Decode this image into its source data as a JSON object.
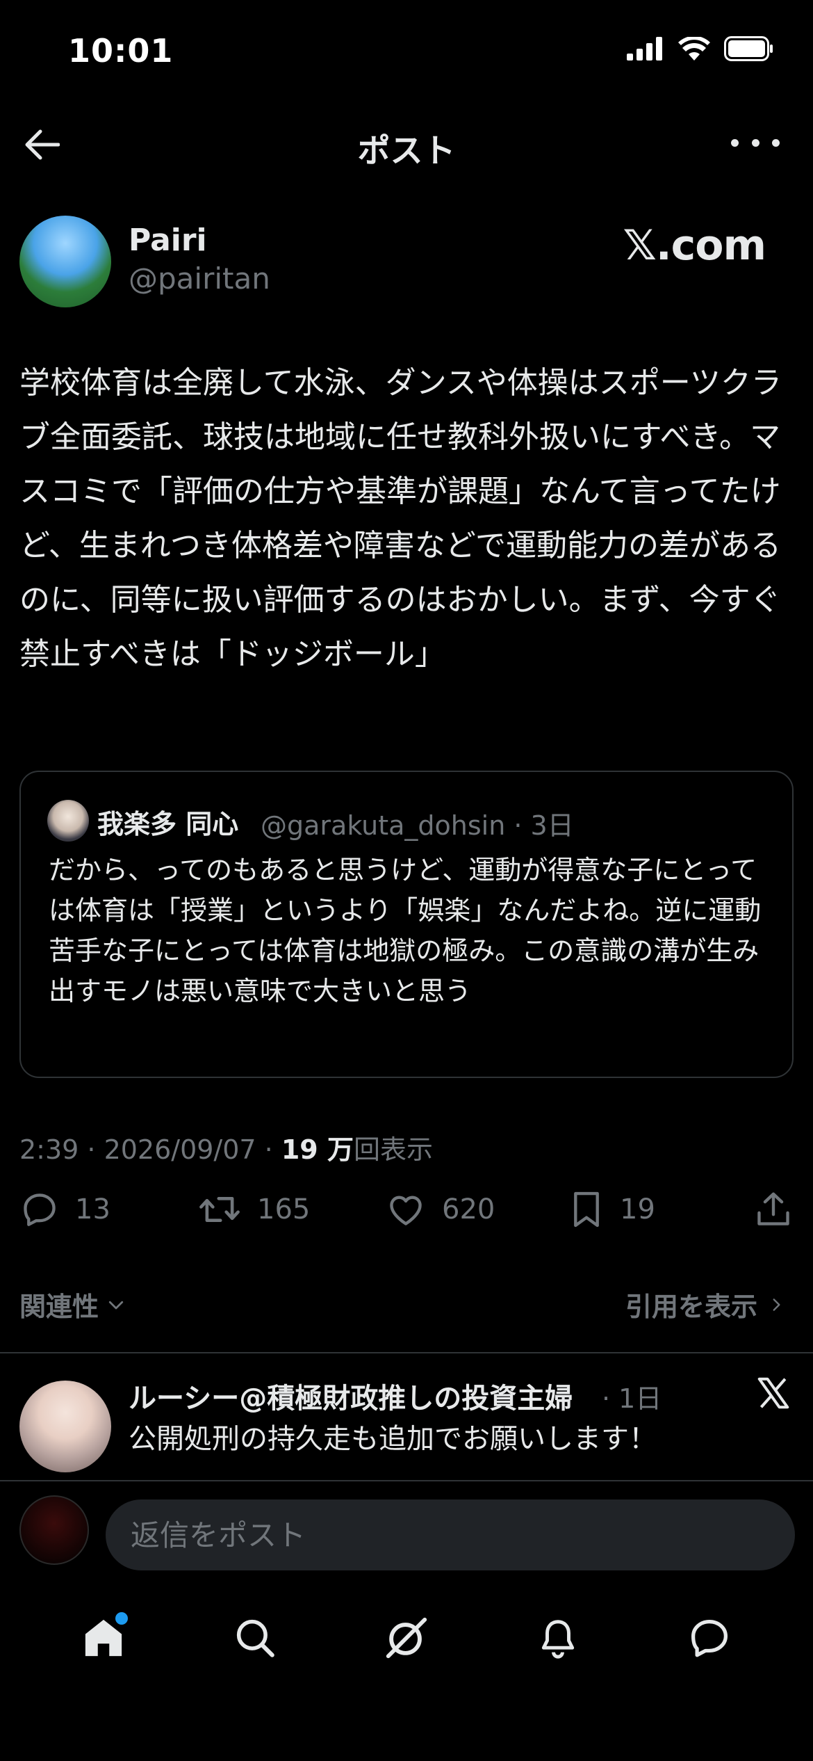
{
  "status_bar": {
    "time": "10:01"
  },
  "header": {
    "title": "ポスト"
  },
  "author": {
    "name": "Pairi",
    "handle": "@pairitan",
    "brand_text": "𝕏.com"
  },
  "post": {
    "text": "学校体育は全廃して水泳、ダンスや体操はスポーツクラブ全面委託、球技は地域に任せ教科外扱いにすべき。マスコミで「評価の仕方や基準が課題」なんて言ってたけど、生まれつき体格差や障害などで運動能力の差があるのに、同等に扱い評価するのはおかしい。まず、今すぐ禁止すべきは「ドッジボール」"
  },
  "quote": {
    "name": "我楽多 同心",
    "handle_time": "@garakuta_dohsin · 3日",
    "text": "だから、ってのもあると思うけど、運動が得意な子にとっては体育は「授業」というより「娯楽」なんだよね。逆に運動苦手な子にとっては体育は地獄の極み。この意識の溝が生み出すモノは悪い意味で大きいと思う"
  },
  "meta": {
    "time_date": "2:39 · 2026/09/07 · ",
    "views_count": "19 万",
    "views_label": "回表示"
  },
  "actions": {
    "replies": "13",
    "reposts": "165",
    "likes": "620",
    "bookmarks": "19"
  },
  "sort": {
    "relevance_label": "関連性",
    "quotes_label": "引用を表示"
  },
  "reply": {
    "name": "ルーシー@積極財政推しの投資主婦",
    "time": "· 1日",
    "text": "公開処刑の持久走も追加でお願いします！"
  },
  "composer": {
    "placeholder": "返信をポスト"
  },
  "colors": {
    "background": "#000000",
    "text": "#e7e9ea",
    "muted": "#71767b",
    "border": "#2f3336",
    "accent": "#1d9bf0",
    "input_bg": "#202327"
  },
  "nav": {
    "items": [
      "home-icon",
      "search-icon",
      "grok-icon",
      "notifications-icon",
      "messages-icon"
    ]
  }
}
